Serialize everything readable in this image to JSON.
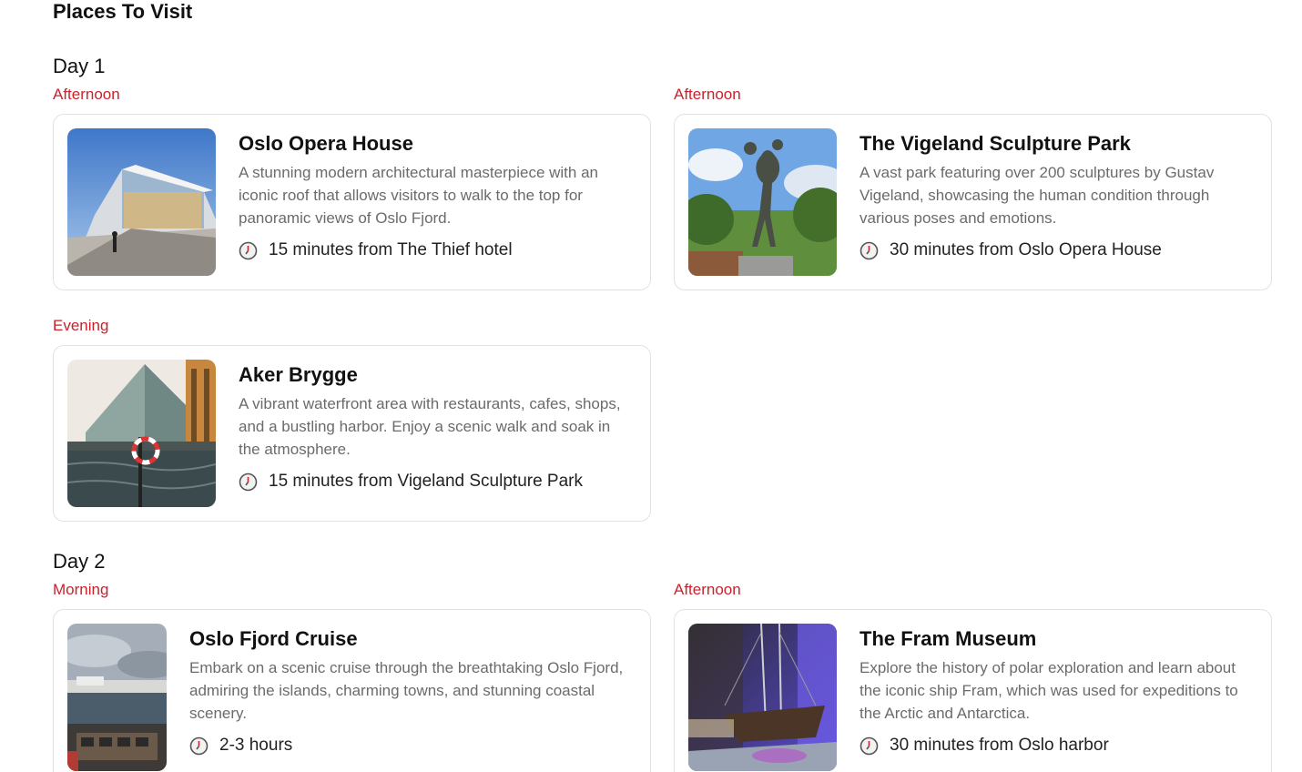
{
  "page": {
    "title": "Places To Visit"
  },
  "colors": {
    "accent": "#c8232c",
    "muted_text": "#6b6b6b",
    "card_border": "#e2e2e2"
  },
  "days": [
    {
      "label": "Day 1",
      "places": [
        {
          "slot": "Afternoon",
          "name": "Oslo Opera House",
          "description": "A stunning modern architectural masterpiece with an iconic roof that allows visitors to walk to the top for panoramic views of Oslo Fjord.",
          "travel": "15 minutes from The Thief hotel",
          "icon": "clock-icon"
        },
        {
          "slot": "Afternoon",
          "name": "The Vigeland Sculpture Park",
          "description": "A vast park featuring over 200 sculptures by Gustav Vigeland, showcasing the human condition through various poses and emotions.",
          "travel": "30 minutes from Oslo Opera House",
          "icon": "clock-icon"
        },
        {
          "slot": "Evening",
          "name": "Aker Brygge",
          "description": "A vibrant waterfront area with restaurants, cafes, shops, and a bustling harbor. Enjoy a scenic walk and soak in the atmosphere.",
          "travel": "15 minutes from Vigeland Sculpture Park",
          "icon": "clock-icon"
        }
      ]
    },
    {
      "label": "Day 2",
      "places": [
        {
          "slot": "Morning",
          "name": "Oslo Fjord Cruise",
          "description": "Embark on a scenic cruise through the breathtaking Oslo Fjord, admiring the islands, charming towns, and stunning coastal scenery.",
          "travel": "2-3 hours",
          "icon": "clock-icon"
        },
        {
          "slot": "Afternoon",
          "name": "The Fram Museum",
          "description": "Explore the history of polar exploration and learn about the iconic ship Fram, which was used for expeditions to the Arctic and Antarctica.",
          "travel": "30 minutes from Oslo harbor",
          "icon": "clock-icon"
        }
      ]
    }
  ]
}
